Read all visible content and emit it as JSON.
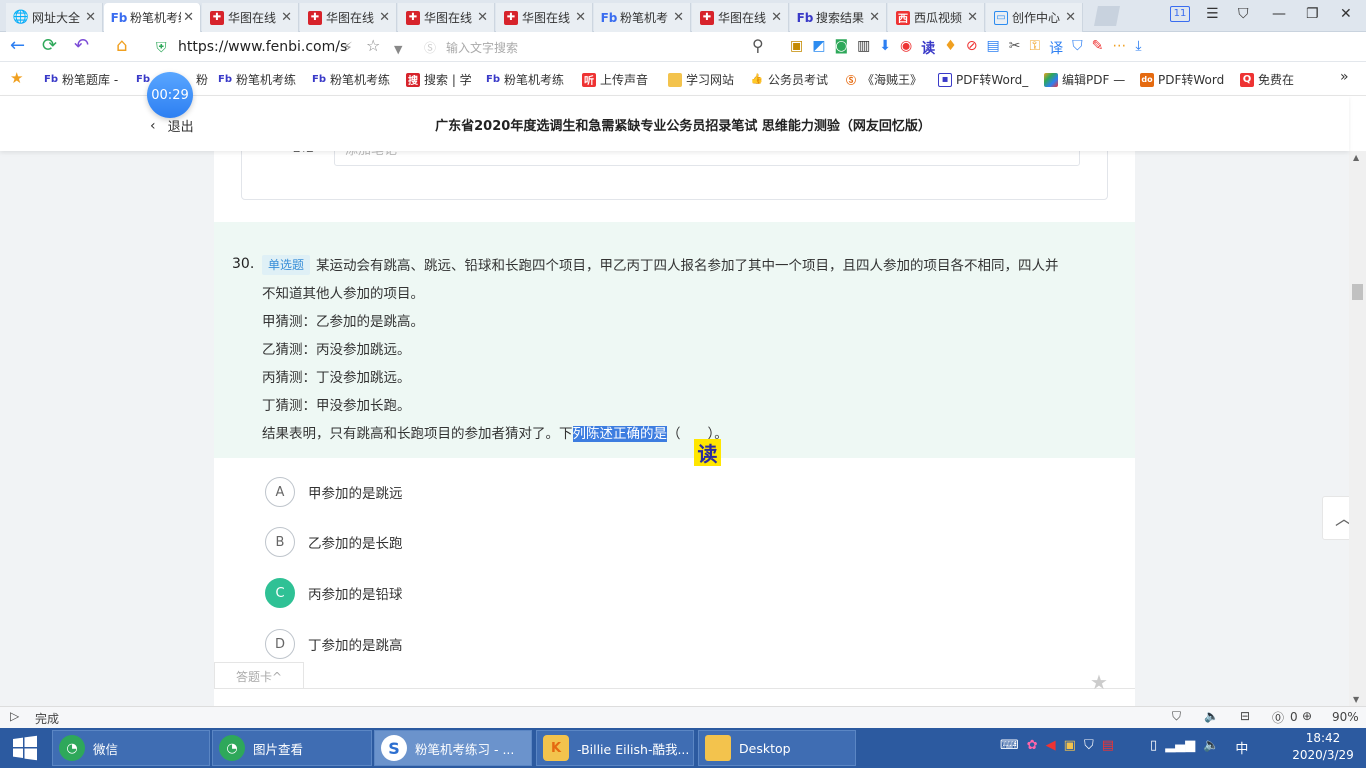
{
  "browser": {
    "tabs": [
      {
        "label": "网址大全",
        "icon": "globe-icon"
      },
      {
        "label": "粉笔机考练",
        "icon": "fenbi-icon",
        "active": true
      },
      {
        "label": "华图在线",
        "icon": "huatu-icon"
      },
      {
        "label": "华图在线",
        "icon": "huatu-icon"
      },
      {
        "label": "华图在线",
        "icon": "huatu-icon"
      },
      {
        "label": "华图在线",
        "icon": "huatu-icon"
      },
      {
        "label": "粉笔机考",
        "icon": "fenbi-icon"
      },
      {
        "label": "华图在线",
        "icon": "huatu-icon"
      },
      {
        "label": "搜索结果",
        "icon": "sogou-icon"
      },
      {
        "label": "西瓜视频",
        "icon": "xigua-icon"
      },
      {
        "label": "创作中心",
        "icon": "creator-icon"
      }
    ],
    "tab_count": "11",
    "url": "https://www.fenbi.com/s",
    "search_placeholder": "输入文字搜索",
    "read_label": "读"
  },
  "bookmarks": [
    {
      "label": "粉笔题库 -",
      "icon": "fenbi-icon"
    },
    {
      "label": "粉",
      "icon": "fenbi-icon"
    },
    {
      "label": "粉笔机考练",
      "icon": "fenbi-icon"
    },
    {
      "label": "粉笔机考练",
      "icon": "fenbi-icon"
    },
    {
      "label": "搜索 | 学",
      "icon": "search-site-icon"
    },
    {
      "label": "粉笔机考练",
      "icon": "fenbi-icon"
    },
    {
      "label": "上传声音",
      "icon": "ting-icon"
    },
    {
      "label": "学习网站",
      "icon": "folder-icon"
    },
    {
      "label": "公务员考试",
      "icon": "thumb-icon"
    },
    {
      "label": "《海贼王》",
      "icon": "sogou-icon"
    },
    {
      "label": "PDF转Word_",
      "icon": "pdf-icon"
    },
    {
      "label": "编辑PDF —",
      "icon": "edit-pdf-icon"
    },
    {
      "label": "PDF转Word",
      "icon": "pdf-word-icon"
    },
    {
      "label": "免费在",
      "icon": "q-icon"
    }
  ],
  "header": {
    "timer": "00:29",
    "exit_label": "退出",
    "title": "广东省2020年度选调生和急需紧缺专业公务员招录笔试 思维能力测验（网友回忆版）"
  },
  "note": {
    "label": "笔记",
    "placeholder": "添加笔记"
  },
  "question": {
    "number": "30.",
    "type": "单选题",
    "stem_line1": "某运动会有跳高、跳远、铅球和长跑四个项目，甲乙丙丁四人报名参加了其中一个项目，且四人参加的项目各不相同，四人并",
    "stem_line2": "不知道其他人参加的项目。",
    "guesses": [
      "甲猜测：乙参加的是跳高。",
      "乙猜测：丙没参加跳远。",
      "丙猜测：丁没参加跳远。",
      "丁猜测：甲没参加长跑。"
    ],
    "result_prefix": "结果表明，只有跳高和长跑项目的参加者猜对了。下",
    "result_highlight": "列陈述正确的是",
    "result_suffix": "（　　）。",
    "read_badge": "读"
  },
  "options": [
    {
      "letter": "A",
      "text": "甲参加的是跳远",
      "selected": false
    },
    {
      "letter": "B",
      "text": "乙参加的是长跑",
      "selected": false
    },
    {
      "letter": "C",
      "text": "丙参加的是铅球",
      "selected": true
    },
    {
      "letter": "D",
      "text": "丁参加的是跳高",
      "selected": false
    }
  ],
  "footer": {
    "answer_card": "答题卡^"
  },
  "statusbar": {
    "status": "完成",
    "download_count": "0",
    "zoom": "90%"
  },
  "taskbar": {
    "items": [
      {
        "label": "微信",
        "icon": "wechat-icon"
      },
      {
        "label": "图片查看",
        "icon": "wechat-icon"
      },
      {
        "label": "粉笔机考练习 - ...",
        "icon": "sogou-browser-icon",
        "active": true
      },
      {
        "label": "-Billie Eilish-酷我...",
        "icon": "kuwo-icon"
      },
      {
        "label": "Desktop",
        "icon": "folder-icon"
      }
    ],
    "ime": "中",
    "time": "18:42",
    "date": "2020/3/29"
  },
  "colors": {
    "accent": "#2fc195",
    "highlight": "#3d7de0",
    "taskbar": "#2c5aa0",
    "question_bg": "#eef8f4"
  }
}
